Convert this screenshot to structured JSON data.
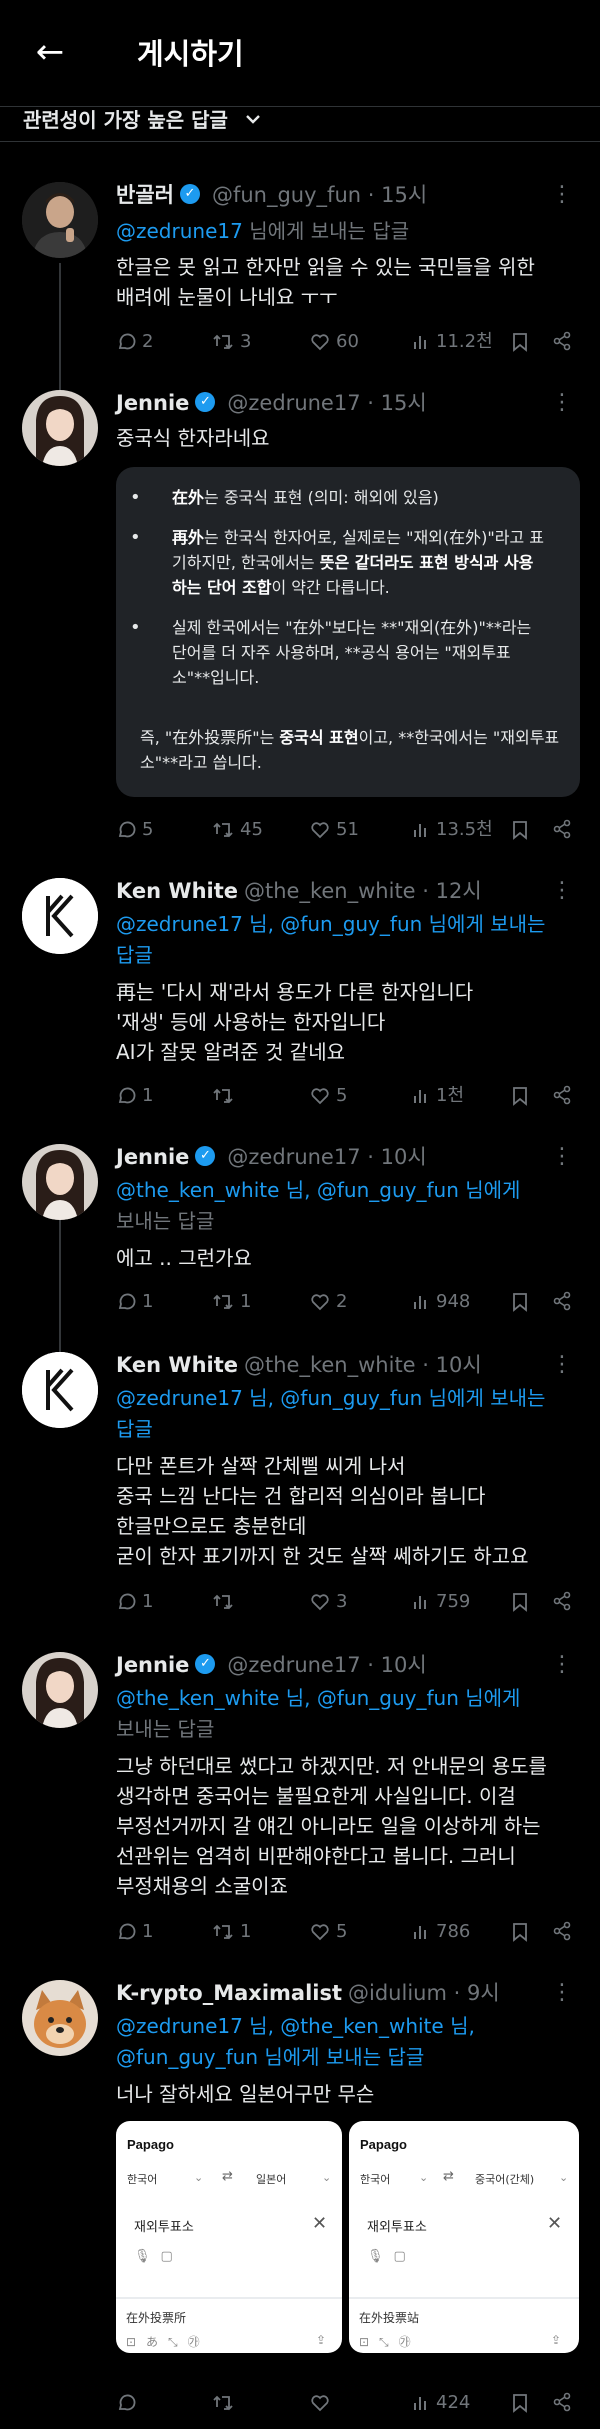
{
  "header": {
    "back_icon": "arrow-left-icon",
    "title": "게시하기"
  },
  "sort": {
    "label": "관련성이 가장 높은 답글"
  },
  "colors": {
    "link": "#1d9bf0",
    "verified": "#1d9bf0",
    "muted": "#71767b"
  },
  "tweets": [
    {
      "name": "반골러",
      "verified": true,
      "handle": "@fun_guy_fun",
      "time": "· 15시",
      "reply_mentions": [
        "@zedrune17"
      ],
      "reply_suffix": "님에게 보내는 답글",
      "body": "한글은 못 읽고 한자만 읽을 수 있는 국민들을 위한\n배려에 눈물이 나네요 ㅜㅜ",
      "replies": "2",
      "retweets": "3",
      "likes": "60",
      "views": "11.2천"
    },
    {
      "name": "Jennie",
      "verified": true,
      "handle": "@zedrune17",
      "time": "· 15시",
      "body": "중국식 한자라네요",
      "ai_box": {
        "b1_bold": "在外",
        "b1_rest": "는 중국식 표현 (의미: 해외에 있음)",
        "b2_bold": "再外",
        "b2_rest1": "는 한국식 한자어로, 실제로는 \"재외(在外)\"라고 표기하지만, 한국에서는 ",
        "b2_bold2": "뜻은 같더라도 표현 방식과 사용하는 단어 조합",
        "b2_rest2": "이 약간 다릅니다.",
        "b3": "실제 한국에서는 \"在外\"보다는 **\"재외(在外)\"**라는 단어를 더 자주 사용하며, **공식 용어는 \"재외투표소\"**입니다.",
        "c_pre": "즉, \"在外投票所\"는 ",
        "c_bold": "중국식 표현",
        "c_post": "이고, **한국에서는 \"재외투표소\"**라고 씁니다."
      },
      "replies": "5",
      "retweets": "45",
      "likes": "51",
      "views": "13.5천"
    },
    {
      "name": "Ken White",
      "verified": false,
      "handle": "@the_ken_white",
      "time": "· 12시",
      "reply_line1": "@zedrune17 님, @fun_guy_fun 님에게 보내는",
      "reply_line2": "답글",
      "body": "再는 '다시 재'라서 용도가 다른 한자입니다\n'재생' 등에 사용하는 한자입니다\nAI가 잘못 알려준 것 같네요",
      "replies": "1",
      "retweets": "",
      "likes": "5",
      "views": "1천"
    },
    {
      "name": "Jennie",
      "verified": true,
      "handle": "@zedrune17",
      "time": "· 10시",
      "reply_line1": "@the_ken_white 님, @fun_guy_fun 님에게",
      "reply_line2": "보내는 답글",
      "body": "에고 .. 그런가요",
      "replies": "1",
      "retweets": "1",
      "likes": "2",
      "views": "948"
    },
    {
      "name": "Ken White",
      "verified": false,
      "handle": "@the_ken_white",
      "time": "· 10시",
      "reply_line1": "@zedrune17 님, @fun_guy_fun 님에게 보내는",
      "reply_line2": "답글",
      "body": "다만 폰트가 살짝 간체삘 씨게 나서\n중국 느낌 난다는 건 합리적 의심이라 봅니다\n한글만으로도 충분한데\n굳이 한자 표기까지 한 것도 살짝 쎄하기도 하고요",
      "replies": "1",
      "retweets": "",
      "likes": "3",
      "views": "759"
    },
    {
      "name": "Jennie",
      "verified": true,
      "handle": "@zedrune17",
      "time": "· 10시",
      "reply_line1": "@the_ken_white 님, @fun_guy_fun 님에게",
      "reply_line2": "보내는 답글",
      "body": "그냥 하던대로 썼다고 하겠지만. 저 안내문의 용도를\n생각하면 중국어는 불필요한게 사실입니다. 이걸\n부정선거까지 갈 얘긴 아니라도 일을 이상하게 하는\n선관위는 엄격히 비판해야한다고 봅니다. 그러니\n부정채용의 소굴이죠",
      "replies": "1",
      "retweets": "1",
      "likes": "5",
      "views": "786"
    },
    {
      "name": "K-rypto_Maximalist",
      "verified": false,
      "handle": "@idulium",
      "time": "· 9시",
      "reply_line1": "@zedrune17 님, @the_ken_white 님,",
      "reply_line2": "@fun_guy_fun 님에게 보내는 답글",
      "body": "너나 잘하세요 일본어구만 무슨",
      "papago": {
        "left": {
          "app": "Papago",
          "src": "한국어",
          "dst": "일본어",
          "input": "재외투표소",
          "output": "在外投票所"
        },
        "right": {
          "app": "Papago",
          "src": "한국어",
          "dst": "중국어(간체)",
          "input": "재외투표소",
          "output": "在外投票站"
        }
      },
      "replies": "",
      "retweets": "",
      "likes": "",
      "views": "424"
    }
  ]
}
